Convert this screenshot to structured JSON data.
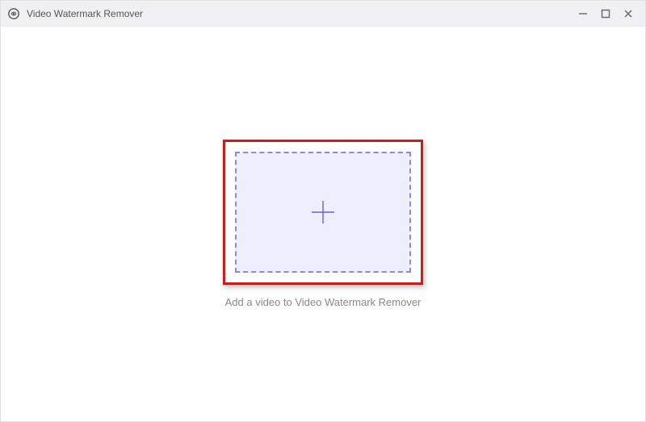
{
  "titlebar": {
    "title": "Video Watermark Remover"
  },
  "main": {
    "prompt": "Add a video to Video Watermark Remover"
  },
  "colors": {
    "accent": "#6b5dd8",
    "highlight": "#d21919",
    "dropzoneBg": "#edefff"
  }
}
